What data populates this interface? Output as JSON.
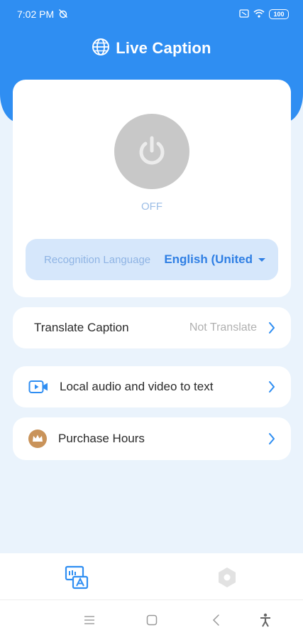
{
  "status_bar": {
    "time": "7:02 PM",
    "battery": "100",
    "icons": [
      "alarm-off-icon",
      "screen-record-icon",
      "wifi-icon",
      "battery-icon"
    ]
  },
  "header": {
    "title": "Live Caption",
    "icon": "globe-icon",
    "color": "#2f8ef2"
  },
  "main": {
    "power_state": "OFF",
    "recognition_label": "Recognition Language",
    "recognition_value": "English (United"
  },
  "rows": {
    "translate": {
      "label": "Translate Caption",
      "value": "Not Translate"
    },
    "local": {
      "label": "Local audio and video to text",
      "icon": "video-camera-icon"
    },
    "purchase": {
      "label": "Purchase Hours",
      "icon": "crown-icon"
    }
  },
  "bottom_nav": {
    "items": [
      {
        "icon": "caption-icon",
        "active": true
      },
      {
        "icon": "settings-gear-icon",
        "active": false
      }
    ]
  },
  "system_nav": [
    "menu-icon",
    "home-icon",
    "back-icon",
    "accessibility-icon"
  ],
  "colors": {
    "accent": "#2f8ef2",
    "background": "#eaf3fc",
    "power_off": "#c8c8c8",
    "crown": "#c9935a"
  }
}
